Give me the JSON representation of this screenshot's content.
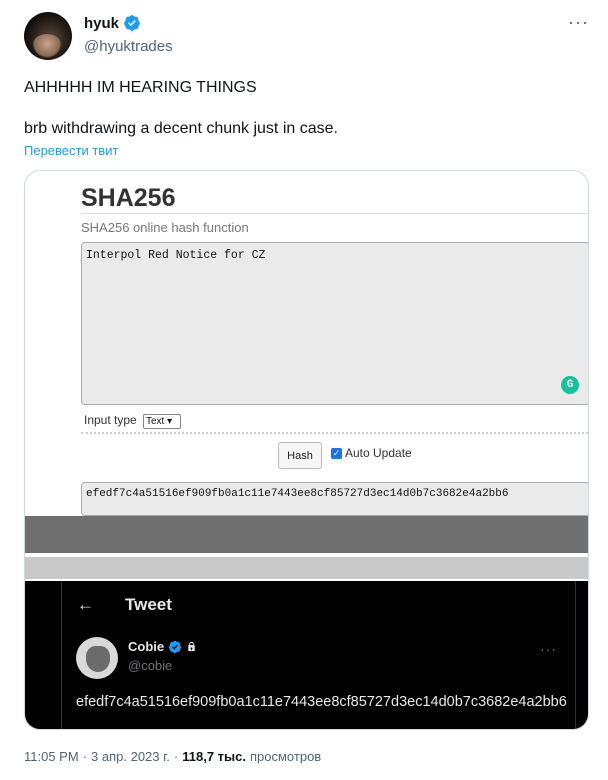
{
  "author": {
    "name": "hyuk",
    "handle": "@hyuktrades"
  },
  "tweet": {
    "line1": "AHHHHH IM HEARING THINGS",
    "line2": "brb withdrawing a decent chunk just in case.",
    "translate_label": "Перевести твит"
  },
  "sha_page": {
    "title": "SHA256",
    "subtitle": "SHA256 online hash function",
    "input_text": "Interpol Red Notice for CZ",
    "input_type_label": "Input type",
    "input_type_value": "Text",
    "hash_button_label": "Hash",
    "auto_update_label": "Auto Update",
    "output_hash": "efedf7c4a51516ef909fb0a1c11e7443ee8cf85727d3ec14d0b7c3682e4a2bb6"
  },
  "embedded_tweet": {
    "header_title": "Tweet",
    "name": "Cobie",
    "handle": "@cobie",
    "text": "efedf7c4a51516ef909fb0a1c11e7443ee8cf85727d3ec14d0b7c3682e4a2bb6"
  },
  "meta": {
    "time": "11:05 PM",
    "separator": "·",
    "date": "3 апр. 2023 г.",
    "separator2": "·",
    "views_count": "118,7 тыс.",
    "views_label": "просмотров"
  },
  "colors": {
    "accent": "#1d9bf0",
    "verified": "#1d9bf0",
    "grammarly": "#15c39a"
  },
  "icons": [
    "verified-badge-icon",
    "more-icon",
    "grammarly-icon",
    "back-arrow-icon",
    "lock-icon"
  ]
}
